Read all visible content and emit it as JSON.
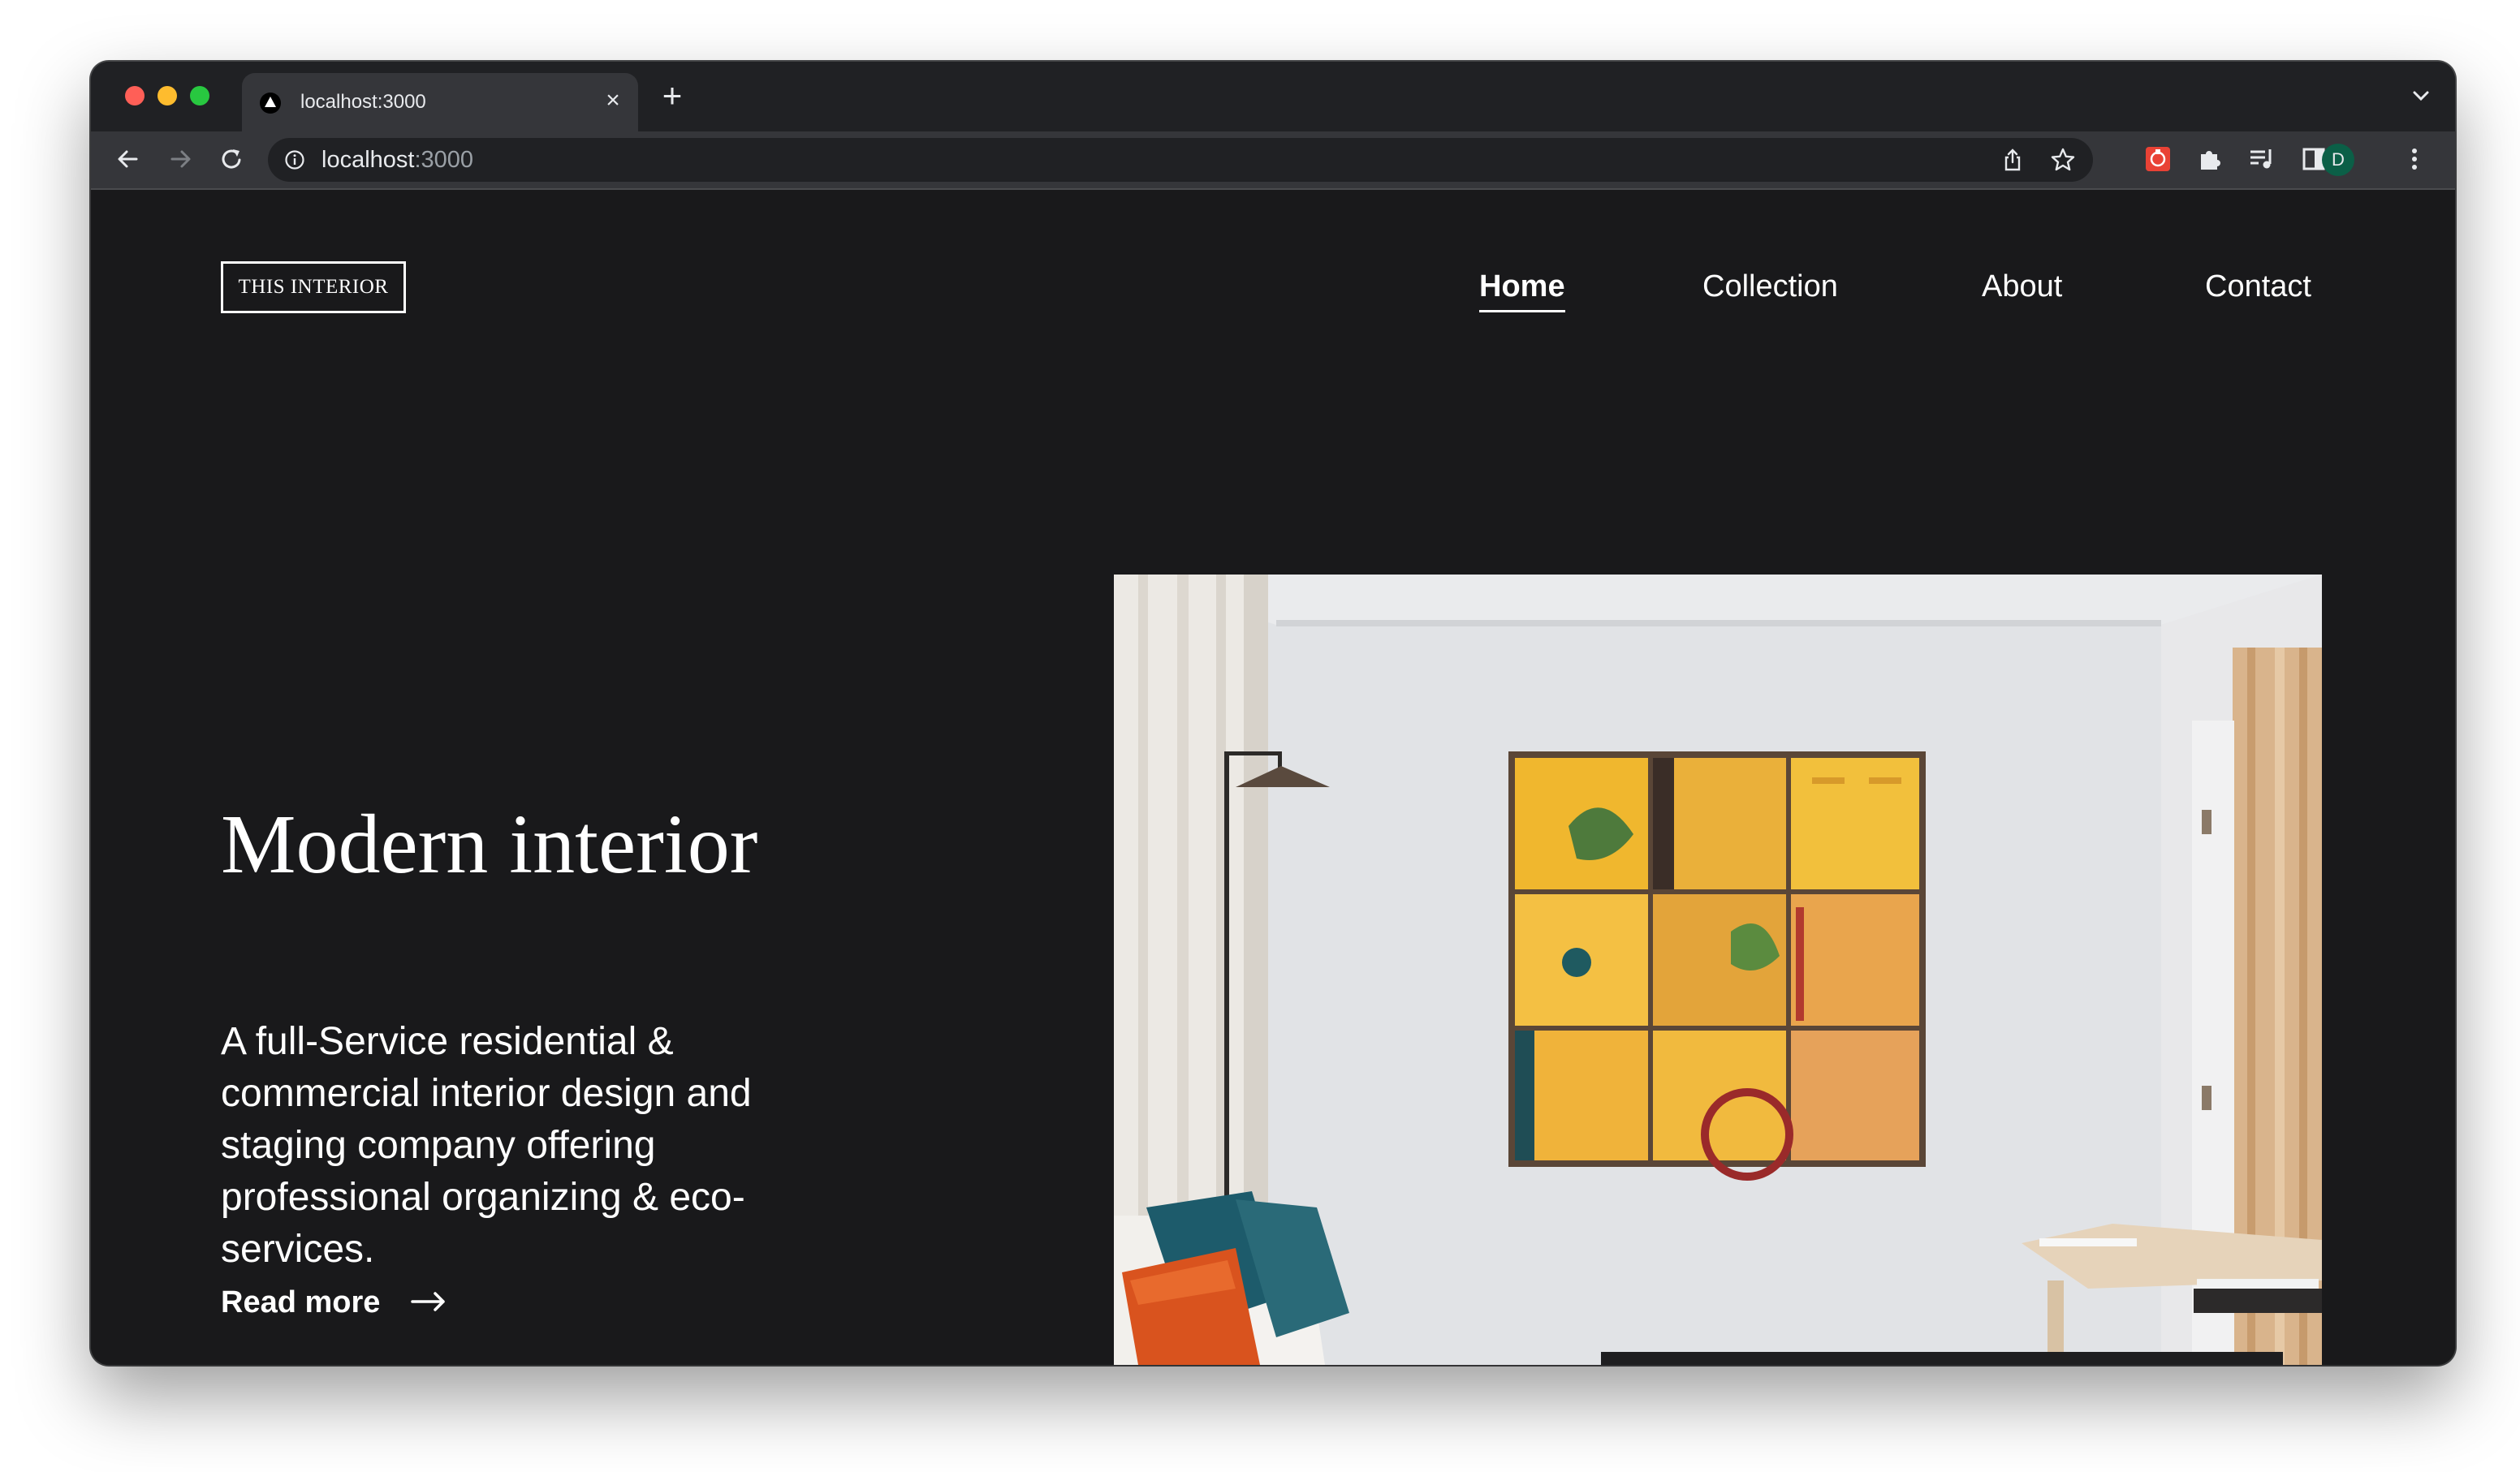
{
  "browser": {
    "tab_title": "localhost:3000",
    "url_host": "localhost",
    "url_port": ":3000",
    "profile_initial": "D",
    "new_tab_symbol": "+",
    "close_symbol": "×"
  },
  "site": {
    "logo": "THIS INTERIOR",
    "nav": {
      "home": "Home",
      "collection": "Collection",
      "about": "About",
      "contact": "Contact"
    },
    "hero": {
      "title": "Modern interior",
      "description": "A full-Service residential & commercial interior design and staging company offering professional organizing & eco-services.",
      "cta": "Read more"
    }
  },
  "icons": [
    "back-arrow-icon",
    "forward-arrow-icon",
    "reload-icon",
    "info-icon",
    "share-icon",
    "star-icon",
    "extension-app-icon",
    "puzzle-icon",
    "reading-list-icon",
    "side-panel-icon",
    "more-vert-icon",
    "chevron-down-icon",
    "arrow-right-icon"
  ],
  "colors": {
    "page_bg": "#19191b",
    "text": "#ffffff",
    "toolbar": "#35363a",
    "tabstrip": "#202124",
    "profile": "#0b5f47",
    "extension_red": "#e94235"
  }
}
